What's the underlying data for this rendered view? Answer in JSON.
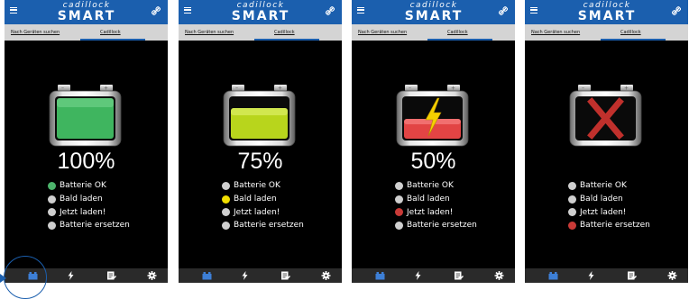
{
  "app": {
    "logo_top": "cadillock",
    "logo_bottom": "SMART",
    "tab_search": "Nach Geräten suchen",
    "tab_device": "Cadillock"
  },
  "status_labels": [
    "Batterie OK",
    "Bald laden",
    "Jetzt laden!",
    "Batterie ersetzen"
  ],
  "screens": [
    {
      "percent": "100%",
      "battery_state": "full",
      "fill_level": 1.0,
      "fill_color": "#3fb55f",
      "active_status": 0,
      "active_color": "#4cb36b"
    },
    {
      "percent": "75%",
      "battery_state": "good",
      "fill_level": 0.75,
      "fill_color": "#b8d51c",
      "active_status": 1,
      "active_color": "#f2df00"
    },
    {
      "percent": "50%",
      "battery_state": "charge",
      "fill_level": 0.5,
      "fill_color": "#e24444",
      "active_status": 2,
      "active_color": "#c93a37",
      "icon": "lightning-icon"
    },
    {
      "percent": "",
      "battery_state": "replace",
      "fill_level": 0,
      "fill_color": "#000000",
      "active_status": 3,
      "active_color": "#c93a37",
      "icon": "x-mark-icon"
    }
  ],
  "bottom_nav": [
    "battery-icon",
    "lightning-icon",
    "notes-icon",
    "gear-icon"
  ],
  "colors": {
    "app_bar": "#1b5fae",
    "tab_bar": "#d4d4d4",
    "screen_background": "#000000",
    "bottom_bar": "#2a2a2a",
    "inactive_dot": "#cfcfcf"
  }
}
